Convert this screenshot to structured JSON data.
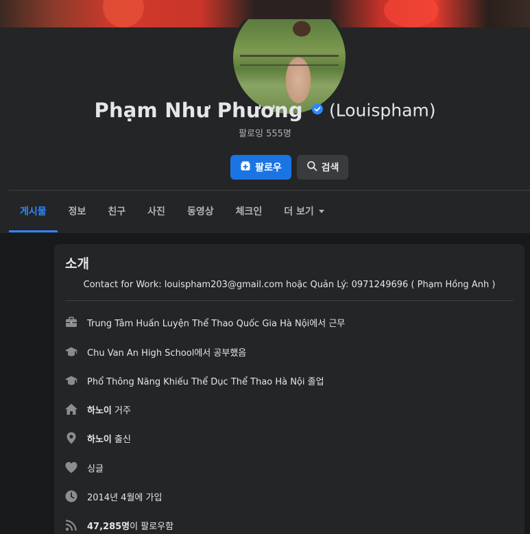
{
  "profile": {
    "name": "Phạm Như Phương",
    "alternate_name": "(Louispham)",
    "following": "팔로잉 555명"
  },
  "actions": {
    "follow_label": "팔로우",
    "search_label": "검색"
  },
  "tabs": [
    {
      "label": "게시물",
      "active": true
    },
    {
      "label": "정보"
    },
    {
      "label": "친구"
    },
    {
      "label": "사진"
    },
    {
      "label": "동영상"
    },
    {
      "label": "체크인"
    },
    {
      "label": "더 보기",
      "dropdown": true
    }
  ],
  "intro": {
    "title": "소개",
    "bio": "Contact for Work: louispham203@gmail.com hoặc Quản Lý: 0971249696 ( Phạm Hồng Anh )",
    "work": "Trung Tâm Huấn Luyện Thể Thao Quốc Gia Hà Nội에서 근무",
    "school1": "Chu Van An High School에서 공부했음",
    "school2": "Phổ Thông Năng Khiếu Thể Dục Thể Thao Hà Nội 졸업",
    "lives_place": "하노이",
    "lives_suffix": " 거주",
    "from_place": "하노이",
    "from_suffix": " 출신",
    "relationship": "싱글",
    "joined": "2014년 4월에 가입",
    "followers_count": "47,285명",
    "followers_suffix": "이 팔로우함"
  },
  "colors": {
    "accent": "#2d88ff",
    "button_primary": "#1b74e4",
    "card_bg": "#242526",
    "page_bg": "#18191a"
  }
}
